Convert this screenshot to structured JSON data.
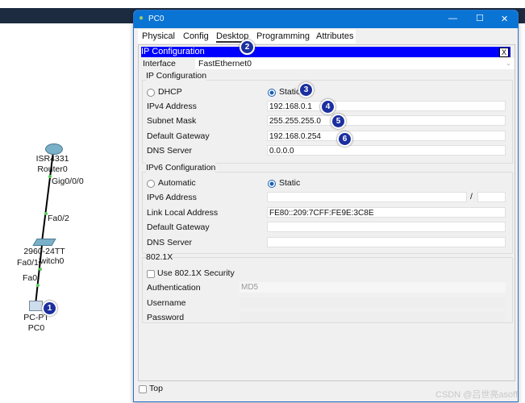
{
  "topology": {
    "router": {
      "model": "ISR4331",
      "name": "Router0",
      "port": "Gig0/0/0"
    },
    "switch": {
      "model": "2960-24TT",
      "name": "Switch0",
      "port_up": "Fa0/2",
      "port_down": "Fa0/1"
    },
    "pc": {
      "model": "PC-PT",
      "name": "PC0",
      "port": "Fa0"
    }
  },
  "window": {
    "title": "PC0",
    "tabs": [
      "Physical",
      "Config",
      "Desktop",
      "Programming",
      "Attributes"
    ],
    "active_tab": "Desktop",
    "controls": {
      "minimize": "—",
      "maximize": "☐",
      "close": "✕"
    }
  },
  "ipconfig": {
    "header": "IP Configuration",
    "close": "X",
    "interface_label": "Interface",
    "interface_value": "FastEthernet0",
    "ipv4": {
      "title": "IP Configuration",
      "dhcp": "DHCP",
      "static": "Static",
      "selected": "Static",
      "rows": [
        {
          "label": "IPv4 Address",
          "value": "192.168.0.1"
        },
        {
          "label": "Subnet Mask",
          "value": "255.255.255.0"
        },
        {
          "label": "Default Gateway",
          "value": "192.168.0.254"
        },
        {
          "label": "DNS Server",
          "value": "0.0.0.0"
        }
      ]
    },
    "ipv6": {
      "title": "IPv6 Configuration",
      "automatic": "Automatic",
      "static": "Static",
      "selected": "Static",
      "rows": [
        {
          "label": "IPv6 Address",
          "value": ""
        },
        {
          "label": "Link Local Address",
          "value": "FE80::209:7CFF:FE9E:3C8E"
        },
        {
          "label": "Default Gateway",
          "value": ""
        },
        {
          "label": "DNS Server",
          "value": ""
        }
      ],
      "prefix_sep": "/"
    },
    "dot1x": {
      "title": "802.1X",
      "use": "Use 802.1X Security",
      "checked": false,
      "auth_label": "Authentication",
      "auth_value": "MD5",
      "username_label": "Username",
      "password_label": "Password"
    }
  },
  "top_label": "Top",
  "watermark": "CSDN @吕世亮asoff",
  "markers": [
    "1",
    "2",
    "3",
    "4",
    "5",
    "6"
  ],
  "colors": {
    "titlebar": "#0a74d4",
    "header": "#0000ff",
    "marker": "#1b2fa0"
  }
}
